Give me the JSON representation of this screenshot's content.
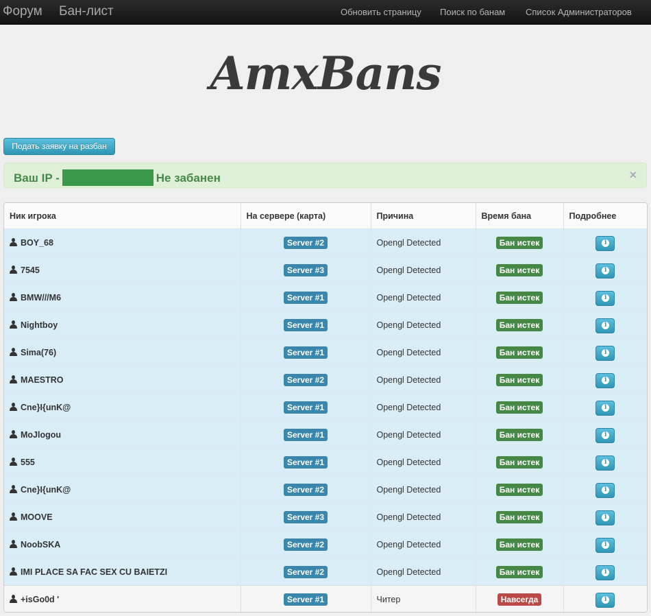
{
  "nav": {
    "forum": "Форум",
    "banlist": "Бан-лист",
    "links": [
      "Обновить страницу",
      "Поиск по банам",
      "Список Администраторов"
    ]
  },
  "logo": "AmxBans",
  "submit_button": "Подать заявку на разбан",
  "alert": {
    "prefix": "Ваш IP -",
    "status": "Не забанен",
    "close": "×"
  },
  "table": {
    "headers": [
      "Ник игрока",
      "На сервере (карта)",
      "Причина",
      "Время бана",
      "Подробнее"
    ],
    "rows": [
      {
        "nick": "BOY_68",
        "server": "Server #2",
        "reason": "Opengl Detected",
        "time": "Бан истек",
        "status": "expired"
      },
      {
        "nick": "7545",
        "server": "Server #3",
        "reason": "Opengl Detected",
        "time": "Бан истек",
        "status": "expired"
      },
      {
        "nick": "BMW///M6",
        "server": "Server #1",
        "reason": "Opengl Detected",
        "time": "Бан истек",
        "status": "expired"
      },
      {
        "nick": "Nightboy",
        "server": "Server #1",
        "reason": "Opengl Detected",
        "time": "Бан истек",
        "status": "expired"
      },
      {
        "nick": "Sima(76)",
        "server": "Server #1",
        "reason": "Opengl Detected",
        "time": "Бан истек",
        "status": "expired"
      },
      {
        "nick": "MAESTRO",
        "server": "Server #2",
        "reason": "Opengl Detected",
        "time": "Бан истек",
        "status": "expired"
      },
      {
        "nick": "Cne}I{unK@",
        "server": "Server #1",
        "reason": "Opengl Detected",
        "time": "Бан истек",
        "status": "expired"
      },
      {
        "nick": "MoJlogou",
        "server": "Server #1",
        "reason": "Opengl Detected",
        "time": "Бан истек",
        "status": "expired"
      },
      {
        "nick": "555",
        "server": "Server #1",
        "reason": "Opengl Detected",
        "time": "Бан истек",
        "status": "expired"
      },
      {
        "nick": "Cne}I{unK@",
        "server": "Server #2",
        "reason": "Opengl Detected",
        "time": "Бан истек",
        "status": "expired"
      },
      {
        "nick": "MOOVE",
        "server": "Server #3",
        "reason": "Opengl Detected",
        "time": "Бан истек",
        "status": "expired"
      },
      {
        "nick": "NoobSKA",
        "server": "Server #2",
        "reason": "Opengl Detected",
        "time": "Бан истек",
        "status": "expired"
      },
      {
        "nick": "IMI PLACE SA FAC SEX CU BAIETZI",
        "server": "Server #2",
        "reason": "Opengl Detected",
        "time": "Бан истек",
        "status": "expired"
      },
      {
        "nick": "+isGo0d '",
        "server": "Server #1",
        "reason": "Читер",
        "time": "Навсегда",
        "status": "permanent"
      }
    ]
  },
  "colors": {
    "navbar": "#1b1b1b",
    "expired_badge": "#468847",
    "permanent_badge": "#b94a48",
    "server_badge": "#3a87ad",
    "alert_bg": "#dff0d8",
    "row_bg": "#d9edf7"
  },
  "icons": {
    "user": "user-icon",
    "info": "info-icon",
    "close": "close-icon"
  }
}
